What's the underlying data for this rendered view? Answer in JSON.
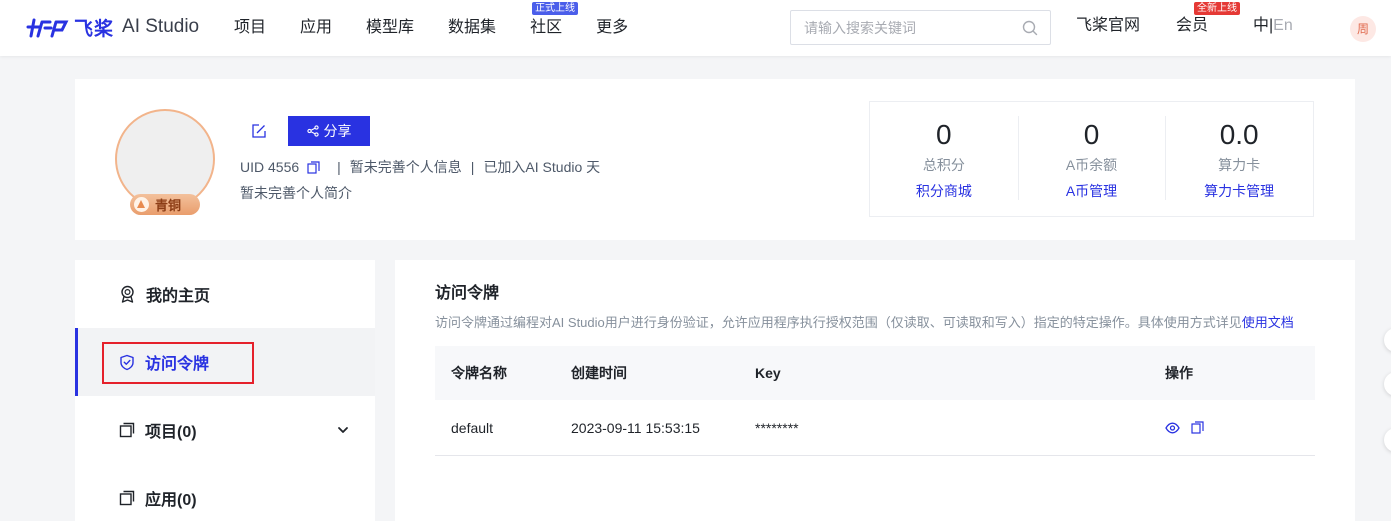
{
  "header": {
    "logo_cn": "飞桨",
    "logo_en": "AI Studio",
    "nav": [
      {
        "label": "项目",
        "badge": ""
      },
      {
        "label": "应用",
        "badge": ""
      },
      {
        "label": "模型库",
        "badge": ""
      },
      {
        "label": "数据集",
        "badge": ""
      },
      {
        "label": "社区",
        "badge": "正式上线"
      },
      {
        "label": "更多",
        "badge": ""
      }
    ],
    "search_placeholder": "请输入搜索关键词",
    "official_site": "飞桨官网",
    "member": "会员",
    "member_badge": "全新上线",
    "lang_active": "中",
    "lang_sep": "|",
    "lang_inactive": "En",
    "user_initial": "周"
  },
  "profile": {
    "level": "青铜",
    "share_label": "分享",
    "uid": "UID 4556",
    "sep": "|",
    "info_status": "暂未完善个人信息",
    "joined": "已加入AI Studio 天",
    "bio": "暂未完善个人简介",
    "stats": [
      {
        "value": "0",
        "label": "总积分",
        "link": "积分商城"
      },
      {
        "value": "0",
        "label": "A币余额",
        "link": "A币管理"
      },
      {
        "value": "0.0",
        "label": "算力卡",
        "link": "算力卡管理"
      }
    ]
  },
  "sidebar": {
    "items": [
      {
        "label": "我的主页"
      },
      {
        "label": "访问令牌"
      },
      {
        "label": "项目(0)"
      },
      {
        "label": "应用(0)"
      }
    ]
  },
  "main": {
    "title": "访问令牌",
    "description": "访问令牌通过编程对AI Studio用户进行身份验证，允许应用程序执行授权范围（仅读取、可读取和写入）指定的特定操作。具体使用方式详见",
    "doc_link": "使用文档",
    "columns": [
      "令牌名称",
      "创建时间",
      "Key",
      "操作"
    ],
    "rows": [
      {
        "name": "default",
        "created": "2023-09-11 15:53:15",
        "key": "********"
      }
    ]
  },
  "colors": {
    "brand": "#2932e1",
    "highlight_box": "#e5202b",
    "level_badge": "#e99d6c"
  }
}
